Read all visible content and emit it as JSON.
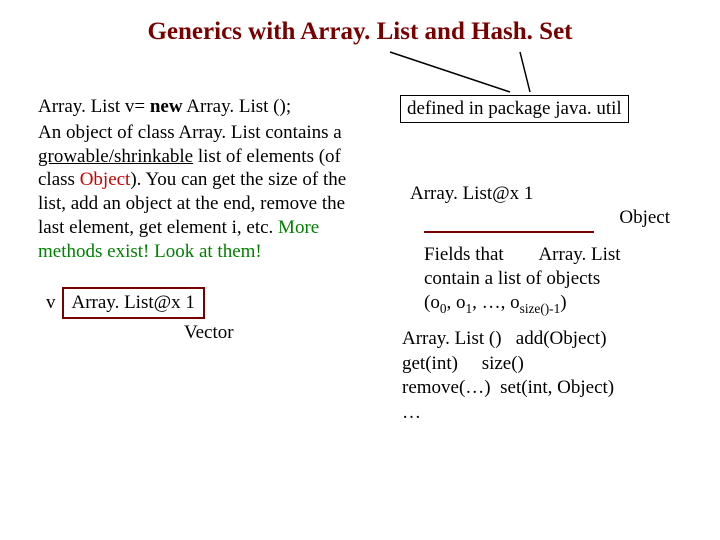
{
  "title": "Generics with Array. List and Hash. Set",
  "left": {
    "code_pre": "Array. List v= ",
    "code_kw": "new",
    "code_post": " Array. List ();",
    "p1a": "An object of class Array. List contains a ",
    "p1_ul": "growable/shrinkable",
    "p1b": " list of elements (of class ",
    "p1_obj": "Object",
    "p1c": "). You can get the size of the list, add an object at the end, remove the last element, get element i, etc. ",
    "p1_more": "More methods exist! Look at them!",
    "v_label": "v",
    "v_value": "Array. List@x 1",
    "vector": "Vector"
  },
  "right": {
    "defined": "defined in package java. util",
    "obj_header": "Array. List@x 1",
    "obj_sub": "Object",
    "fields_a": "Fields that",
    "fields_al": "Array. List",
    "fields_b": "contain a list of objects",
    "fields_seq_open": "(o",
    "fields_s0": "0",
    "fields_comma1": ", o",
    "fields_s1": "1",
    "fields_mid": ", …, o",
    "fields_ssize": "size()-1",
    "fields_seq_close": ")",
    "m1a": "Array. List ()",
    "m1b": "add(Object)",
    "m2a": "get(int)",
    "m2b": "size()",
    "m3a": "remove(…)",
    "m3b": "set(int, Object)",
    "m4": "…"
  }
}
